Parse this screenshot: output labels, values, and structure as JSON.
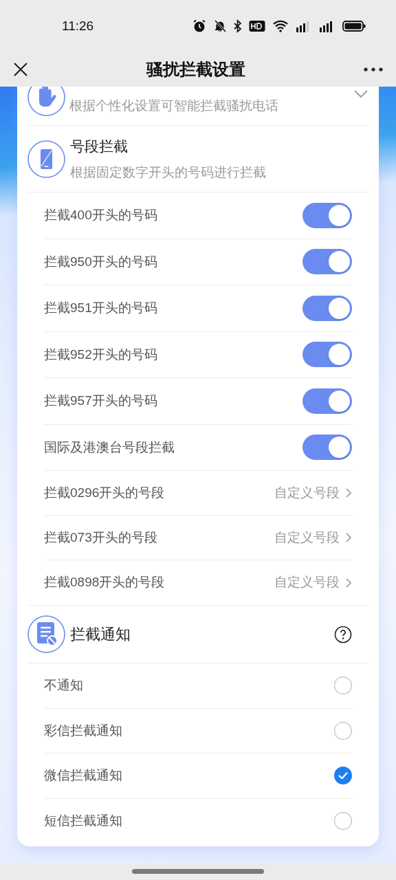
{
  "status_bar": {
    "time": "11:26"
  },
  "header": {
    "title": "骚扰拦截设置"
  },
  "smart_section": {
    "subtitle": "根据个性化设置可智能拦截骚扰电话",
    "expanded": false
  },
  "prefix_section": {
    "title": "号段拦截",
    "subtitle": "根据固定数字开头的号码进行拦截"
  },
  "prefix_rows": [
    {
      "kind": "toggle",
      "label": "拦截400开头的号码",
      "on": true
    },
    {
      "kind": "toggle",
      "label": "拦截950开头的号码",
      "on": true
    },
    {
      "kind": "toggle",
      "label": "拦截951开头的号码",
      "on": true
    },
    {
      "kind": "toggle",
      "label": "拦截952开头的号码",
      "on": true
    },
    {
      "kind": "toggle",
      "label": "拦截957开头的号码",
      "on": true
    },
    {
      "kind": "toggle",
      "label": "国际及港澳台号段拦截",
      "on": true
    },
    {
      "kind": "link",
      "label": "拦截0296开头的号段",
      "value": "自定义号段"
    },
    {
      "kind": "link",
      "label": "拦截073开头的号段",
      "value": "自定义号段"
    },
    {
      "kind": "link",
      "label": "拦截0898开头的号段",
      "value": "自定义号段"
    }
  ],
  "notify_section": {
    "title": "拦截通知"
  },
  "notify_options": [
    {
      "label": "不通知",
      "selected": false
    },
    {
      "label": "彩信拦截通知",
      "selected": false
    },
    {
      "label": "微信拦截通知",
      "selected": true
    },
    {
      "label": "短信拦截通知",
      "selected": false
    }
  ]
}
